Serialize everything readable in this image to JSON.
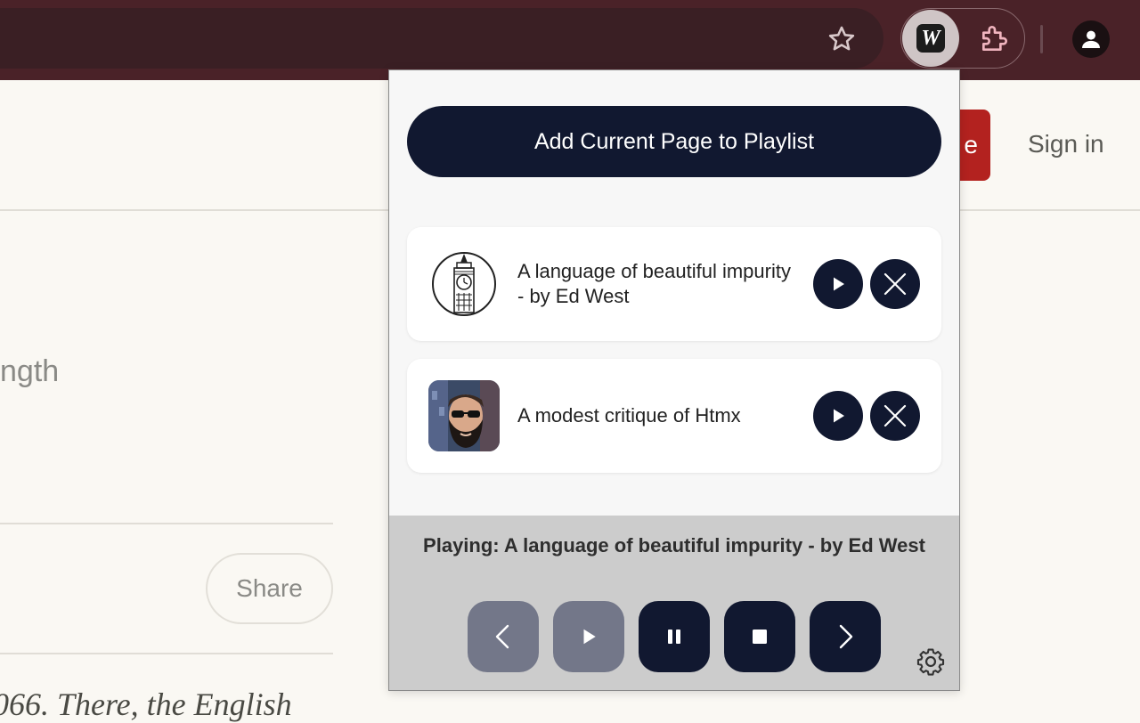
{
  "browser": {
    "icons": {
      "bookmark": "star-icon",
      "extension": "w-extension-icon",
      "extensions_menu": "puzzle-icon",
      "profile": "person-icon"
    },
    "extension_letter": "W"
  },
  "page": {
    "subscribe_partial": "e",
    "sign_in": "Sign in",
    "body_fragment": "ngth",
    "share": "Share",
    "italic_fragment": "066. There, the English"
  },
  "popup": {
    "add_button": "Add Current Page to Playlist",
    "playlist": [
      {
        "title": "A language of beautiful impurity - by Ed West",
        "thumb": "big-ben-icon"
      },
      {
        "title": "A modest critique of Htmx",
        "thumb": "bearded-man-avatar"
      }
    ],
    "now_playing": "Playing: A language of beautiful impurity - by Ed West",
    "controls": [
      "prev-icon",
      "play-icon",
      "pause-icon",
      "stop-icon",
      "next-icon"
    ],
    "colors": {
      "primary": "#111830",
      "disabled": "#737789",
      "player_bg": "#cccccc"
    }
  }
}
